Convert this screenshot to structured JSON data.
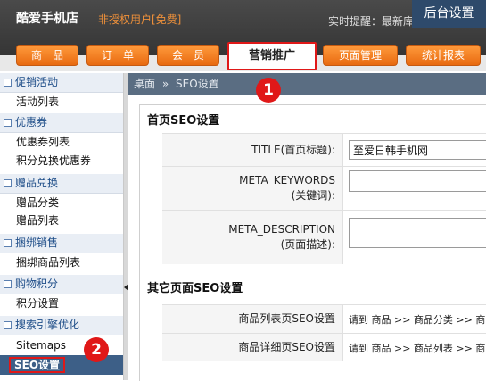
{
  "header": {
    "logo": "酷爱手机店",
    "unauthorized": "非授权用户[免费]",
    "notice": "实时提醒：最新库",
    "admin_settings": "后台设置"
  },
  "nav": {
    "tabs": [
      {
        "label": "商　品"
      },
      {
        "label": "订　单"
      },
      {
        "label": "会　员"
      },
      {
        "label": "营销推广",
        "active": true
      },
      {
        "label": "页面管理"
      },
      {
        "label": "统计报表"
      }
    ]
  },
  "sidebar": {
    "sections": [
      {
        "title": "促销活动",
        "items": [
          "活动列表"
        ]
      },
      {
        "title": "优惠券",
        "items": [
          "优惠券列表",
          "积分兑换优惠券"
        ]
      },
      {
        "title": "赠品兑换",
        "items": [
          "赠品分类",
          "赠品列表"
        ]
      },
      {
        "title": "捆绑销售",
        "items": [
          "捆绑商品列表"
        ]
      },
      {
        "title": "购物积分",
        "items": [
          "积分设置"
        ]
      },
      {
        "title": "搜索引擎优化",
        "items": [
          "Sitemaps",
          "SEO设置"
        ]
      }
    ],
    "active_item": "SEO设置"
  },
  "breadcrumb": {
    "home": "桌面",
    "sep": "»",
    "current": "SEO设置"
  },
  "homepage_seo": {
    "title": "首页SEO设置",
    "fields": [
      {
        "label_line1": "TITLE(首页标题):",
        "label_line2": "",
        "value": "至爱日韩手机网"
      },
      {
        "label_line1": "META_KEYWORDS",
        "label_line2": "(关键词):",
        "value": ""
      },
      {
        "label_line1": "META_DESCRIPTION",
        "label_line2": "(页面描述):",
        "value": ""
      }
    ]
  },
  "other_seo": {
    "title": "其它页面SEO设置",
    "rows": [
      {
        "label": "商品列表页SEO设置",
        "path": "请到 商品 >> 商品分类 >> 商"
      },
      {
        "label": "商品详细页SEO设置",
        "path": "请到 商品 >> 商品列表 >> 商"
      }
    ]
  },
  "markers": [
    "1",
    "2"
  ],
  "colors": {
    "accent": "#e86a10",
    "highlight": "#e01818",
    "sidebar_head": "#e9eef5",
    "breadcrumb_bg": "#5a6d82"
  }
}
